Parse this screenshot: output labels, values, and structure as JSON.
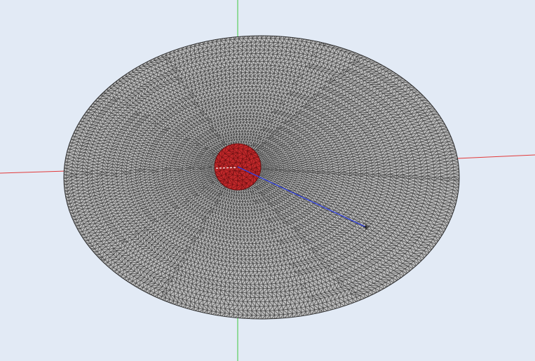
{
  "viewport": {
    "background_color": "#e2eaf5",
    "view": "3d-mesh-view"
  },
  "axes": {
    "x_axis_color": "#e23a3a",
    "y_axis_color": "#3ec83e"
  },
  "mesh": {
    "surface_color": "#bcbcbc",
    "edge_color": "#2b2b2b",
    "shape": "elliptical-disk",
    "refinement": "dense-near-center-coarse-outward"
  },
  "inclusion": {
    "fill_color": "#c0282a",
    "edge_color": "#6e1012",
    "shape": "circle"
  },
  "vector": {
    "color": "#2f3fd8",
    "tip_marker_color": "#111111"
  },
  "icons": {
    "vector_tip": "crosshair-icon"
  }
}
